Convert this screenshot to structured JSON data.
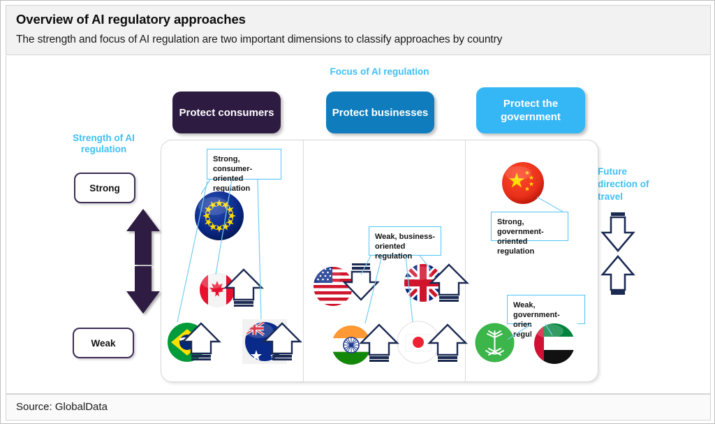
{
  "header": {
    "title": "Overview of AI regulatory approaches",
    "subtitle": "The strength and focus of AI regulation are two important dimensions to classify approaches by country"
  },
  "footer": {
    "source": "Source: GlobalData"
  },
  "axes": {
    "focus_label": "Focus of AI regulation",
    "strength_label": "Strength of AI regulation",
    "future_label": "Future direction of travel",
    "strong_label": "Strong",
    "weak_label": "Weak"
  },
  "colors": {
    "accent_blue": "#3fc0f5",
    "column_1": "#2d1b42",
    "column_2": "#0f7dbd",
    "column_3": "#35b6f5",
    "arrow_navy": "#1b2a52",
    "arrow_purple": "#3b2a55",
    "callout_border": "#4fc3f7"
  },
  "columns": [
    {
      "id": "protect-consumers",
      "label": "Protect consumers"
    },
    {
      "id": "protect-businesses",
      "label": "Protect businesses"
    },
    {
      "id": "protect-government",
      "label": "Protect the government"
    }
  ],
  "callouts": [
    {
      "id": "callout-strong-consumer",
      "text": "Strong, consumer-oriented regulation"
    },
    {
      "id": "callout-weak-business",
      "text": "Weak, business-oriented regulation"
    },
    {
      "id": "callout-strong-government",
      "text": "Strong, government-oriented regulation"
    },
    {
      "id": "callout-weak-government",
      "text": "Weak, government-oriented regulation"
    }
  ],
  "countries": [
    {
      "id": "european-union",
      "name": "European Union",
      "column": "protect-consumers",
      "strength": "strong",
      "trend": "none"
    },
    {
      "id": "canada",
      "name": "Canada",
      "column": "protect-consumers",
      "strength": "medium",
      "trend": "up"
    },
    {
      "id": "brazil",
      "name": "Brazil",
      "column": "protect-consumers",
      "strength": "weak",
      "trend": "up"
    },
    {
      "id": "australia",
      "name": "Australia",
      "column": "protect-consumers",
      "strength": "weak",
      "trend": "up"
    },
    {
      "id": "united-states",
      "name": "United States",
      "column": "protect-businesses",
      "strength": "medium",
      "trend": "down"
    },
    {
      "id": "united-kingdom",
      "name": "United Kingdom",
      "column": "protect-businesses",
      "strength": "medium",
      "trend": "up"
    },
    {
      "id": "india",
      "name": "India",
      "column": "protect-businesses",
      "strength": "weak",
      "trend": "up"
    },
    {
      "id": "japan",
      "name": "Japan",
      "column": "protect-businesses",
      "strength": "weak",
      "trend": "up"
    },
    {
      "id": "china",
      "name": "China",
      "column": "protect-government",
      "strength": "strong",
      "trend": "none"
    },
    {
      "id": "saudi-arabia",
      "name": "Saudi Arabia",
      "column": "protect-government",
      "strength": "weak",
      "trend": "none"
    },
    {
      "id": "uae",
      "name": "United Arab Emirates",
      "column": "protect-government",
      "strength": "weak",
      "trend": "none"
    }
  ]
}
